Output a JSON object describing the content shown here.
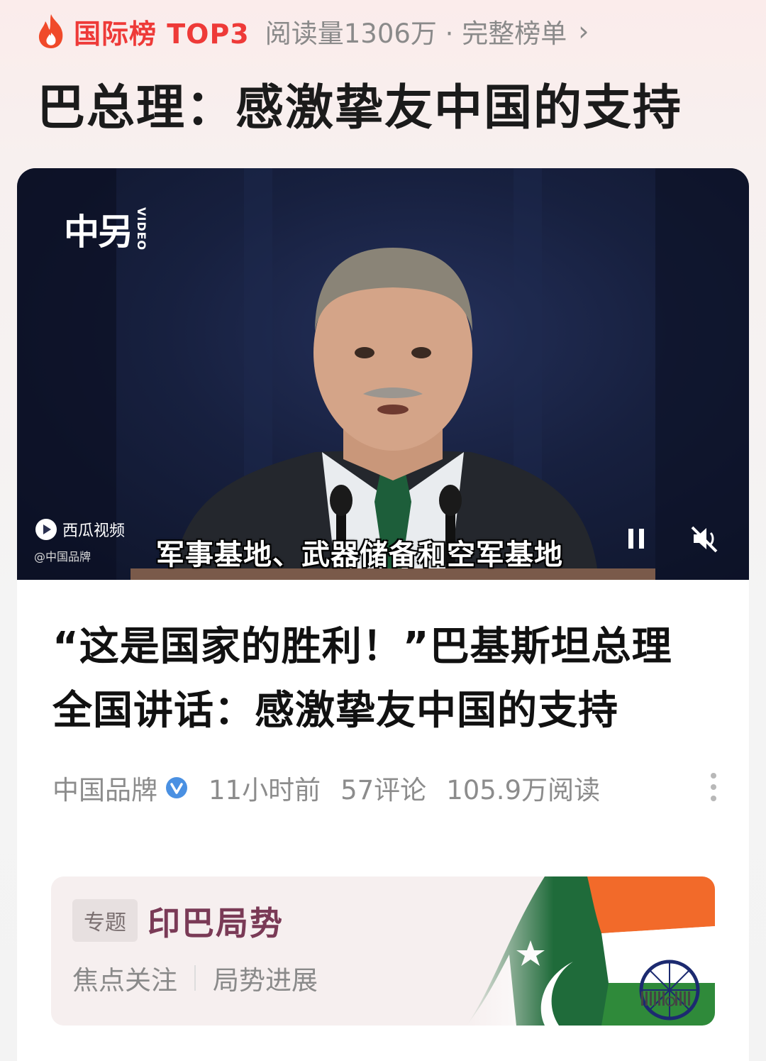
{
  "rank": {
    "label": "国际榜 TOP3",
    "meta": "阅读量1306万 · 完整榜单",
    "chevron": "›"
  },
  "headline": "巴总理：感激挚友中国的支持",
  "video": {
    "brand": "中另",
    "brand_sub": "VIDEO",
    "platform": "西瓜视频",
    "handle": "@中国品牌",
    "subtitle": "军事基地、武器储备和空军基地",
    "state": "playing",
    "muted": true
  },
  "article": {
    "title_line1": "“这是国家的胜利！”巴基斯坦总理",
    "title_line2": "全国讲话：感激挚友中国的支持",
    "author": "中国品牌",
    "time": "11小时前",
    "comments": "57评论",
    "reads": "105.9万阅读"
  },
  "topic": {
    "tag": "专题",
    "title": "印巴局势",
    "link1": "焦点关注",
    "link2": "局势进展"
  },
  "colors": {
    "accent": "#ee3a38",
    "topic_title": "#7a3a56",
    "meta_gray": "#8c8c8c"
  },
  "icons": [
    "flame-icon",
    "xigua-play-icon",
    "pause-icon",
    "mute-icon",
    "verified-icon",
    "more-vertical-icon",
    "chevron-right-icon"
  ]
}
